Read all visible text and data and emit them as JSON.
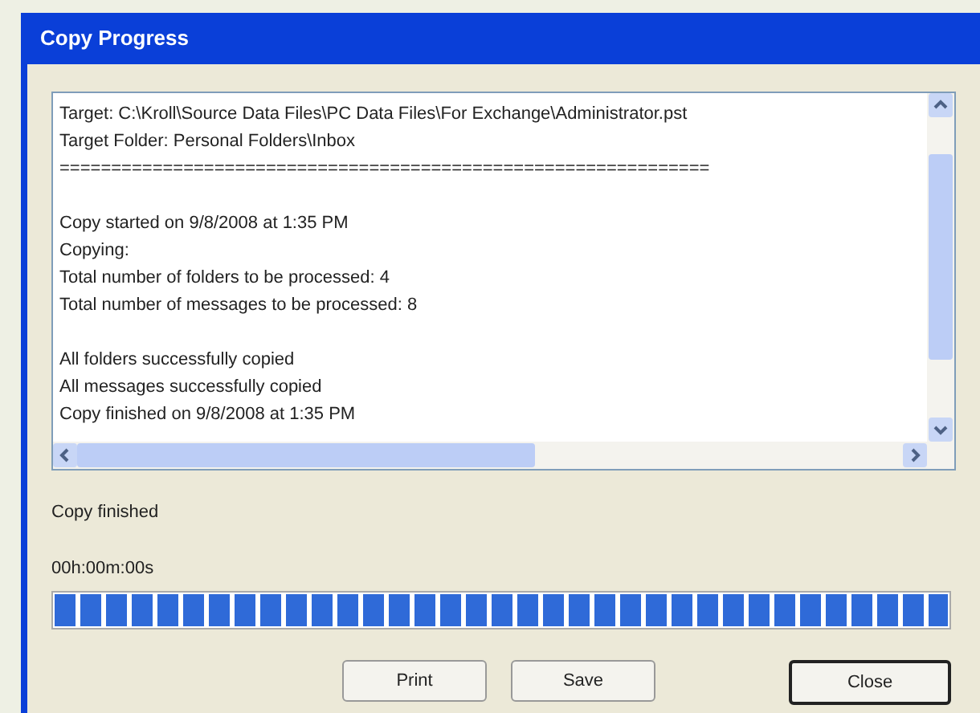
{
  "window": {
    "title": "Copy Progress"
  },
  "log": [
    [
      "Target: C:\\Kroll\\Source Data Files\\PC Data Files\\For Exchange\\Administrator.pst",
      "Target Folder: Personal Folders\\Inbox",
      "==============================================================="
    ],
    [
      "Copy started on 9/8/2008 at 1:35 PM",
      "Copying:",
      "Total number of folders to be processed: 4",
      "Total number of messages to be processed: 8"
    ],
    [
      "All folders successfully copied",
      "All messages successfully copied",
      "Copy finished on 9/8/2008 at 1:35 PM"
    ]
  ],
  "status": "Copy finished",
  "elapsed": "00h:00m:00s",
  "progress": {
    "level": 1
  },
  "buttons": [
    {
      "label": "Print",
      "default": false
    },
    {
      "label": "Save",
      "default": false
    },
    {
      "label": "Close",
      "default": true
    }
  ]
}
